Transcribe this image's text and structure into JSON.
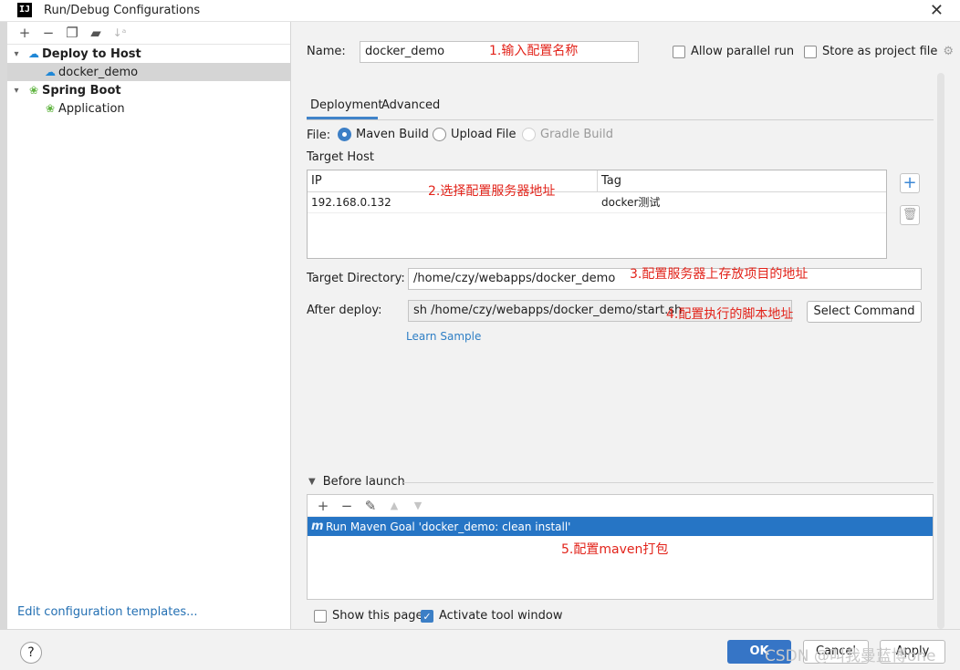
{
  "window": {
    "title": "Run/Debug Configurations",
    "app_icon": "IJ"
  },
  "left": {
    "toolbar": [
      "add-icon",
      "remove-icon",
      "copy-icon",
      "folder-icon",
      "sort-icon"
    ],
    "tree": [
      {
        "label": "Deploy to Host",
        "icon": "cloud-icon"
      },
      {
        "label": "docker_demo",
        "icon": "cloud-icon"
      },
      {
        "label": "Spring Boot",
        "icon": "spring-icon"
      },
      {
        "label": "Application",
        "icon": "spring-icon"
      }
    ],
    "edit_templates": "Edit configuration templates..."
  },
  "form": {
    "name_label": "Name:",
    "name_value": "docker_demo",
    "allow_parallel": "Allow parallel run",
    "store_project": "Store as project file",
    "tabs": [
      "Deployment",
      "Advanced"
    ],
    "file_label": "File:",
    "file_options": [
      "Maven Build",
      "Upload File",
      "Gradle Build"
    ],
    "target_host_label": "Target Host",
    "table": {
      "headers": [
        "IP",
        "Tag"
      ],
      "rows": [
        [
          "192.168.0.132",
          "docker测试"
        ]
      ]
    },
    "target_dir_label": "Target Directory:",
    "target_dir_value": "/home/czy/webapps/docker_demo",
    "after_deploy_label": "After deploy:",
    "after_deploy_value": "sh /home/czy/webapps/docker_demo/start.sh",
    "select_command": "Select Command",
    "learn_sample": "Learn Sample"
  },
  "before_launch": {
    "label": "Before launch",
    "task": "Run Maven Goal 'docker_demo: clean install'"
  },
  "show_page": "Show this page",
  "activate_tool": "Activate tool window",
  "annotations": {
    "n1": "1.输入配置名称",
    "n2": "2.选择配置服务器地址",
    "n3": "3.配置服务器上存放项目的地址",
    "n4": "4.配置执行的脚本地址",
    "n5": "5.配置maven打包"
  },
  "buttons": {
    "help": "?",
    "ok": "OK",
    "cancel": "Cancel",
    "apply": "Apply"
  },
  "watermark": "CSDN @叫我曼蓝博one",
  "colors": {
    "accent": "#3675c6",
    "selection": "#2675c5",
    "annotation": "#e2231a"
  }
}
